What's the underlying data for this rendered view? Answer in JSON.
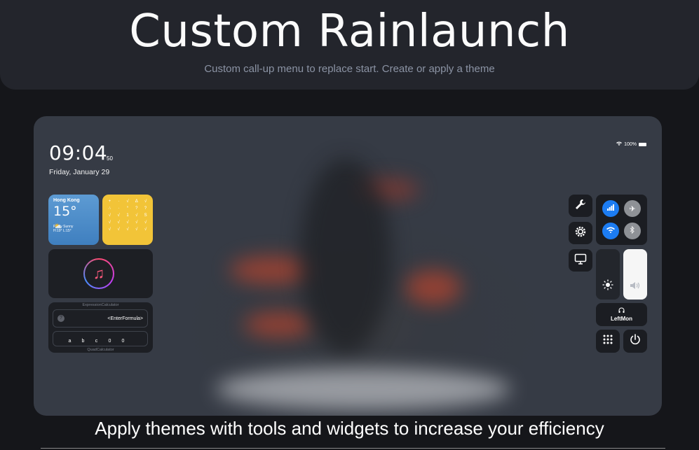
{
  "hero": {
    "title": "Custom Rainlaunch",
    "subtitle": "Custom call-up menu to replace start.  Create or apply a theme"
  },
  "screen": {
    "clock": {
      "time": "09:04",
      "seconds": "50",
      "date": "Friday, January 29"
    },
    "status": {
      "battery": "100%"
    },
    "weather": {
      "city": "Hong Kong",
      "temp": "15°",
      "condition": "Partly Sunny",
      "hilo": "H:19° L:15°"
    },
    "calc_symbols": [
      "+",
      "·",
      "√",
      "Δ",
      "√",
      "∴",
      "·",
      "°",
      "?",
      "?",
      "√",
      "√",
      "1",
      "√",
      "S",
      "√",
      "√",
      "√",
      "√",
      "√",
      "√",
      "√",
      "√",
      "√",
      "√"
    ],
    "music": {
      "icon": "music-note-icon"
    },
    "expression": {
      "label": "ExpressionCalculator",
      "formula": "<EnterFormula>",
      "quad_vars": [
        "a",
        "b",
        "c",
        "0",
        "0"
      ],
      "quad_label": "QuadCalculator"
    },
    "control": {
      "output_label": "LeftMon"
    }
  },
  "caption": "Apply themes with tools and widgets to increase your efficiency",
  "colors": {
    "accent": "#1c7cf2",
    "calc": "#f2c438",
    "weather": "#4f8fcb"
  }
}
